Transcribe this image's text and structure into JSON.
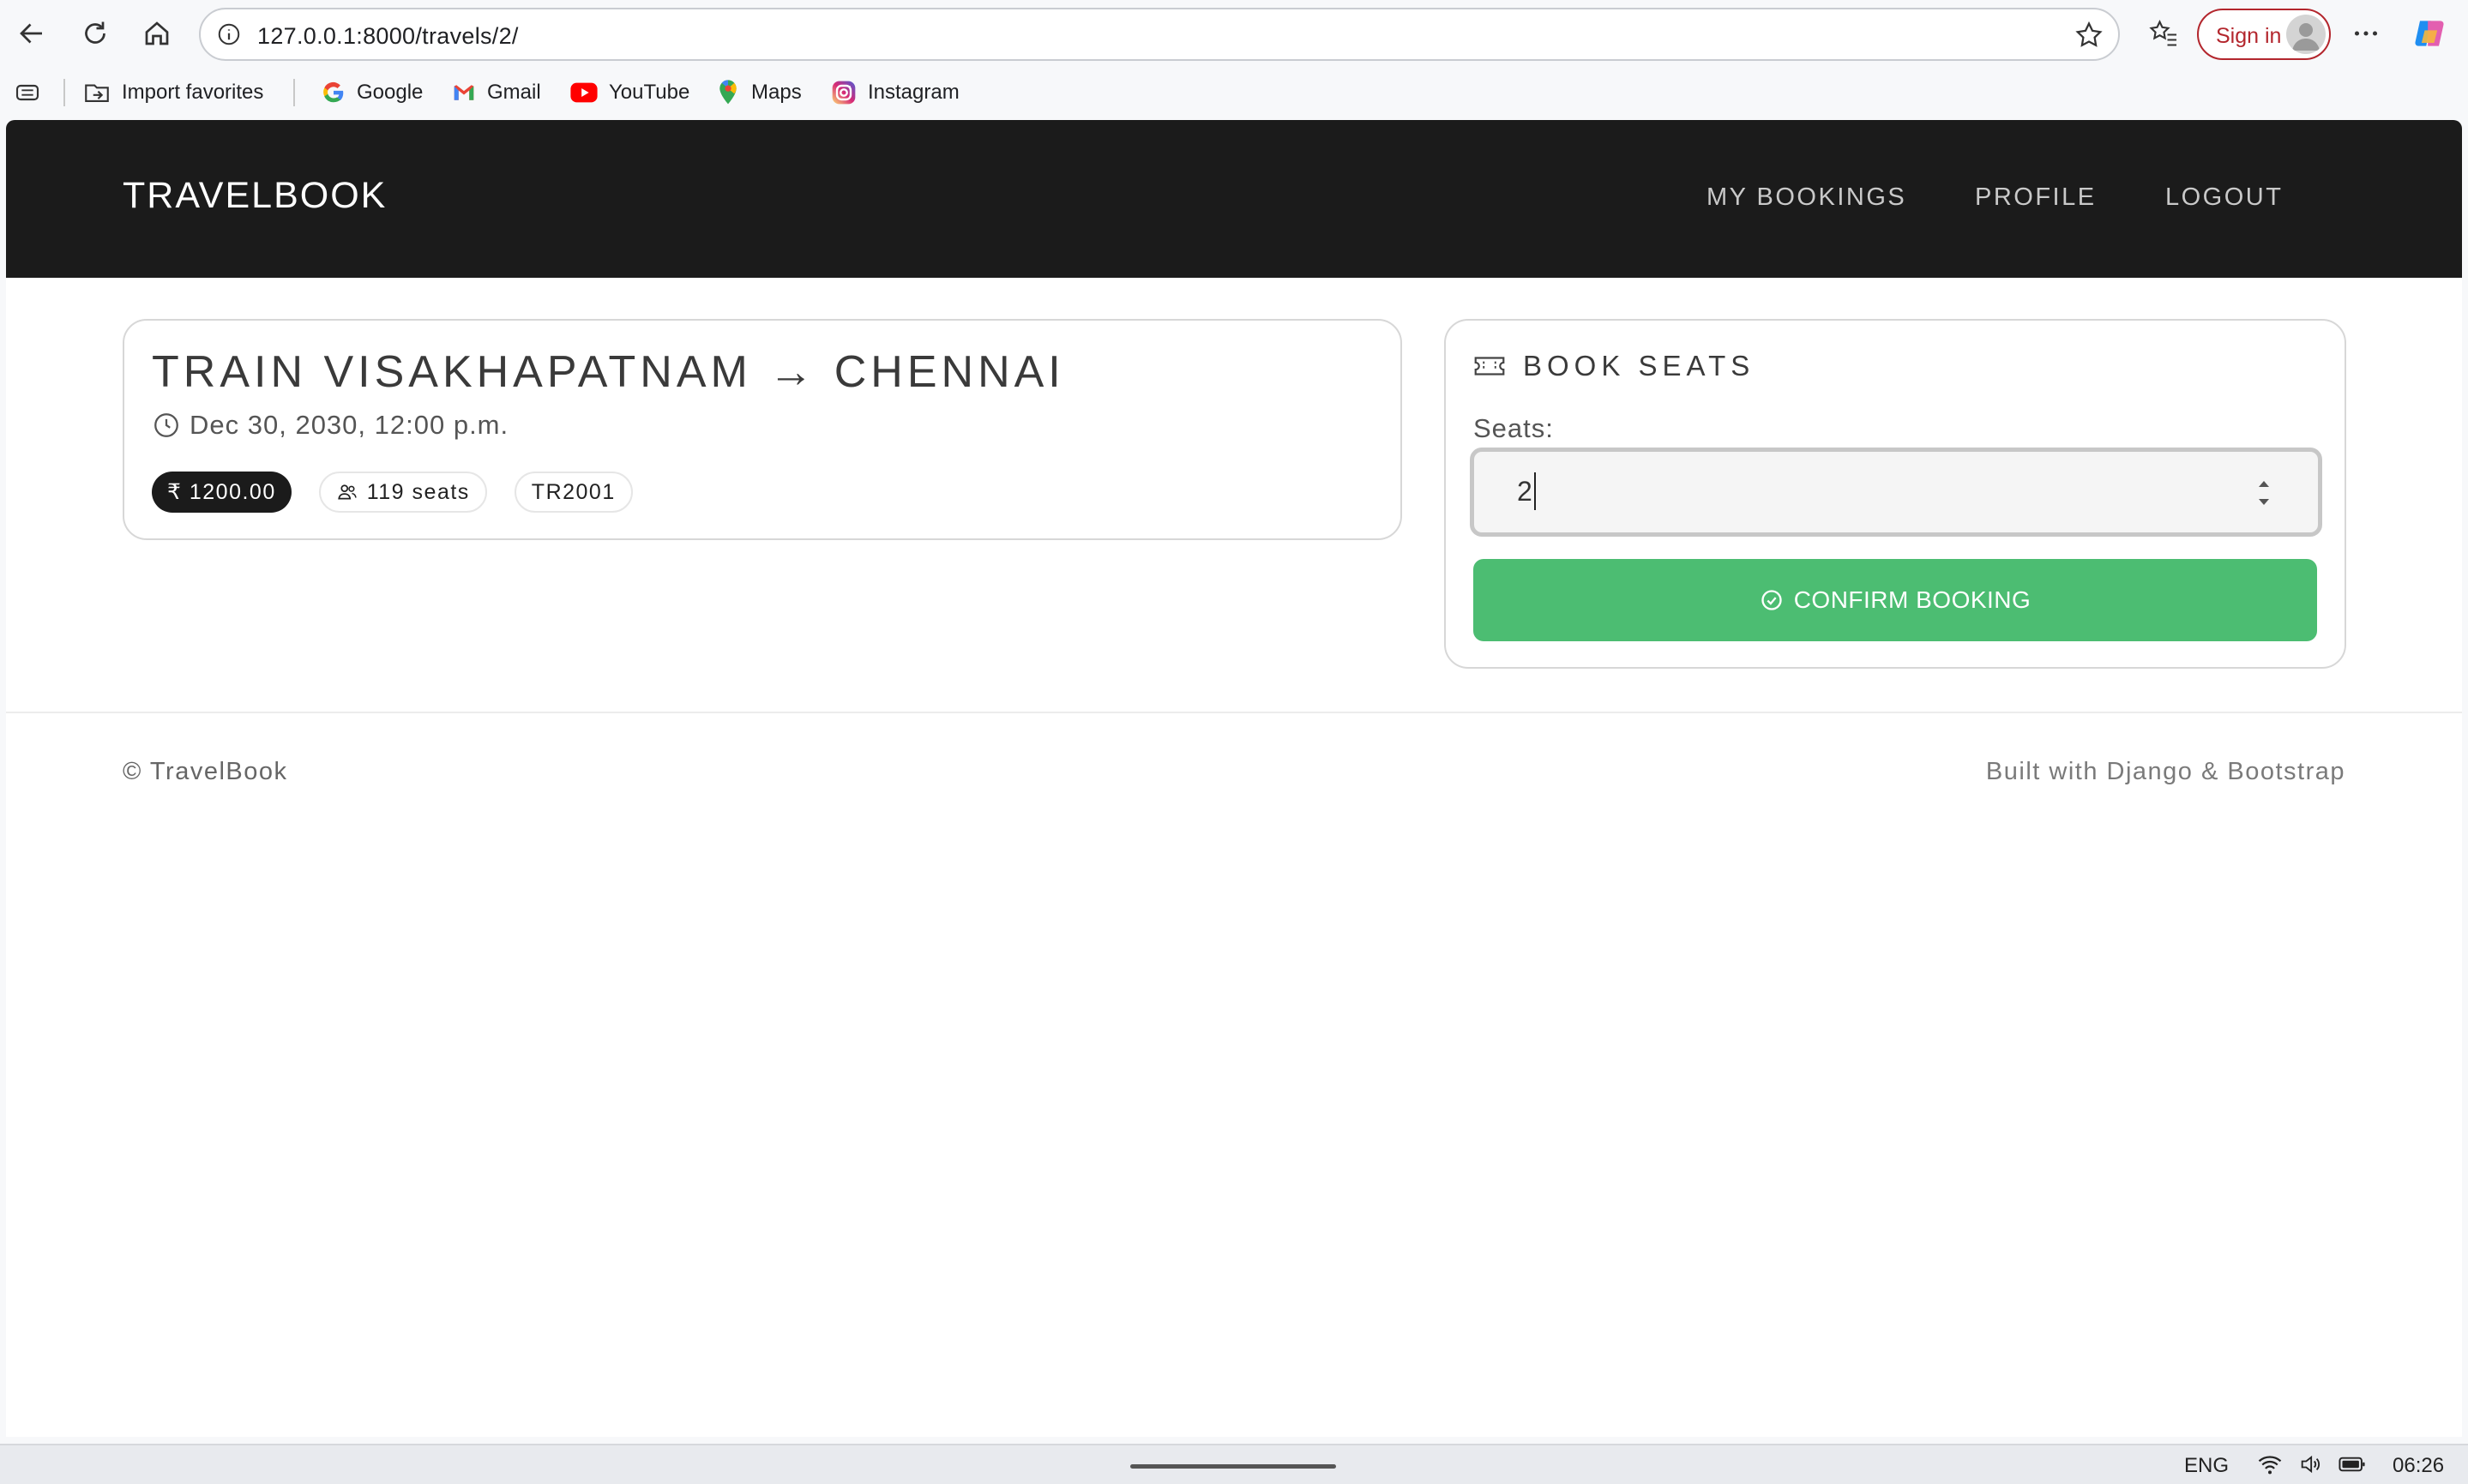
{
  "browser": {
    "url": "127.0.0.1:8000/travels/2/",
    "sign_in": "Sign in"
  },
  "bookmarks": [
    {
      "label": "Import favorites",
      "icon": "import-favorites-icon"
    },
    {
      "label": "Google",
      "icon": "google-icon"
    },
    {
      "label": "Gmail",
      "icon": "gmail-icon"
    },
    {
      "label": "YouTube",
      "icon": "youtube-icon"
    },
    {
      "label": "Maps",
      "icon": "maps-icon"
    },
    {
      "label": "Instagram",
      "icon": "instagram-icon"
    }
  ],
  "site": {
    "brand": "TRAVELBOOK",
    "nav": [
      "MY BOOKINGS",
      "PROFILE",
      "LOGOUT"
    ]
  },
  "trip": {
    "title": "TRAIN VISAKHAPATNAM → CHENNAI",
    "datetime": "Dec 30, 2030, 12:00 p.m.",
    "price": "₹ 1200.00",
    "seats": "119 seats",
    "code": "TR2001"
  },
  "booking": {
    "heading": "BOOK SEATS",
    "seats_label": "Seats:",
    "seats_value": "2",
    "confirm_label": "CONFIRM BOOKING"
  },
  "footer": {
    "left": "© TravelBook",
    "right": "Built with Django & Bootstrap"
  },
  "taskbar": {
    "lang": "ENG",
    "time": "06:26"
  },
  "colors": {
    "nav_bg": "#1b1b1b",
    "confirm_bg": "#4cbd72",
    "signin_border": "#b3262d"
  }
}
